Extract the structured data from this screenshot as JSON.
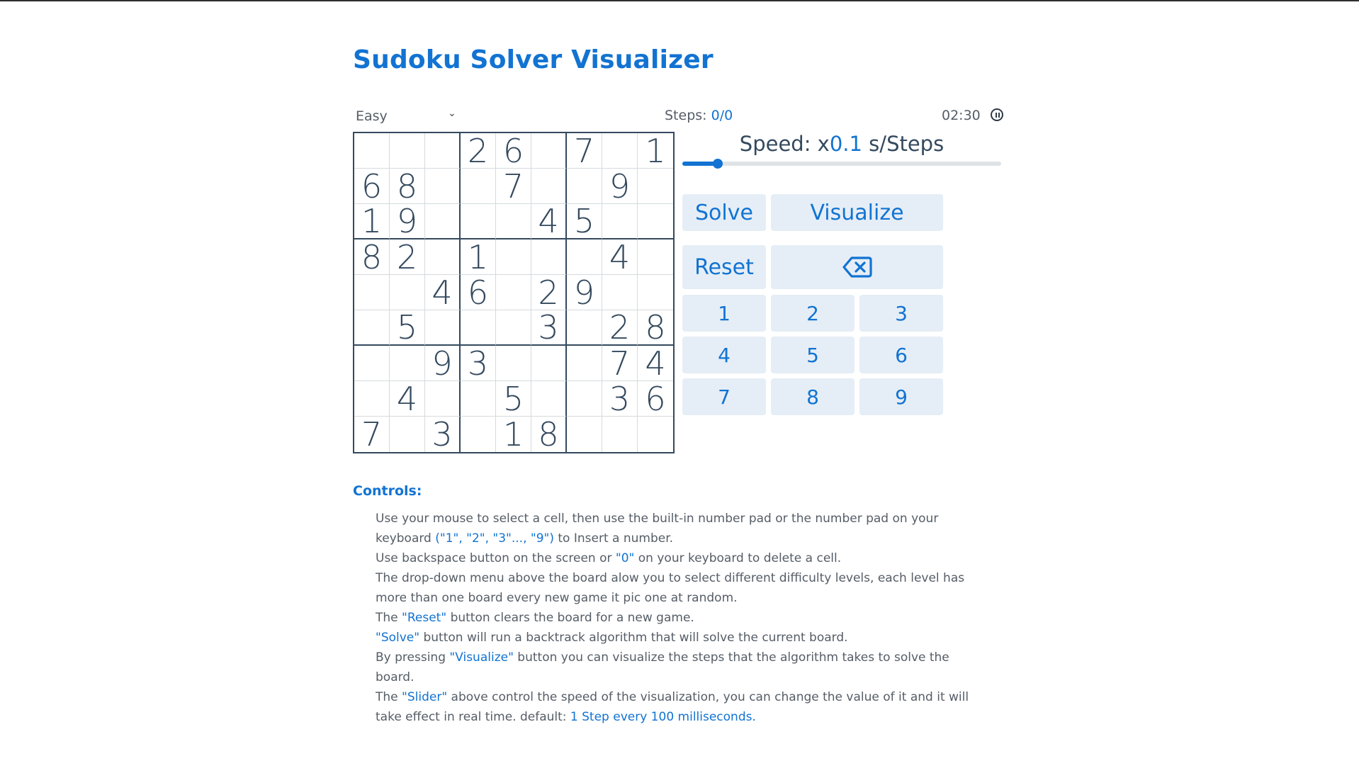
{
  "title": "Sudoku Solver Visualizer",
  "difficulty": {
    "selected": "Easy",
    "options": [
      "Easy"
    ]
  },
  "steps": {
    "label": "Steps:",
    "value": "0/0"
  },
  "timer": "02:30",
  "speed": {
    "label_prefix": "Speed: x",
    "value": "0.1",
    "label_suffix": " s/Steps",
    "slider_level": 0.11
  },
  "buttons": {
    "solve": "Solve",
    "visualize": "Visualize",
    "reset": "Reset",
    "backspace_icon": "backspace-icon"
  },
  "numpad": [
    "1",
    "2",
    "3",
    "4",
    "5",
    "6",
    "7",
    "8",
    "9"
  ],
  "board": [
    [
      "",
      "",
      "",
      "2",
      "6",
      "",
      "7",
      "",
      "1"
    ],
    [
      "6",
      "8",
      "",
      "",
      "7",
      "",
      "",
      "9",
      ""
    ],
    [
      "1",
      "9",
      "",
      "",
      "",
      "4",
      "5",
      "",
      ""
    ],
    [
      "8",
      "2",
      "",
      "1",
      "",
      "",
      "",
      "4",
      ""
    ],
    [
      "",
      "",
      "4",
      "6",
      "",
      "2",
      "9",
      "",
      ""
    ],
    [
      "",
      "5",
      "",
      "",
      "",
      "3",
      "",
      "2",
      "8"
    ],
    [
      "",
      "",
      "9",
      "3",
      "",
      "",
      "",
      "7",
      "4"
    ],
    [
      "",
      "4",
      "",
      "",
      "5",
      "",
      "",
      "3",
      "6"
    ],
    [
      "7",
      "",
      "3",
      "",
      "1",
      "8",
      "",
      "",
      ""
    ]
  ],
  "controls": {
    "heading": "Controls:",
    "items": [
      {
        "t1": "Use your mouse to select a cell, then use the built-in number pad or the number pad on your keyboard ",
        "h1": "(\"1\", \"2\", \"3\"..., \"9\")",
        "t2": " to Insert a number."
      },
      {
        "t1": "Use backspace button on the screen or ",
        "h1": "\"0\"",
        "t2": " on your keyboard to delete a cell."
      },
      {
        "t1": "The drop-down menu above the board alow you to select different difficulty levels, each level has more than one board every new game it pic one at random."
      },
      {
        "t1": "The ",
        "h1": "\"Reset\"",
        "t2": " button clears the board for a new game."
      },
      {
        "h1": "\"Solve\"",
        "t2": " button will run a backtrack algorithm that will solve the current board."
      },
      {
        "t1": "By pressing ",
        "h1": "\"Visualize\"",
        "t2": " button you can visualize the steps that the algorithm takes to solve the board."
      },
      {
        "t1": "The ",
        "h1": "\"Slider\"",
        "t2": " above control the speed of the visualization, you can change the value of it and it will take effect in real time. default: ",
        "h2": "1 Step every 100 milliseconds."
      }
    ]
  },
  "colors": {
    "accent": "#1273d2",
    "button_bg": "#e5eef6",
    "board_text": "#34495e"
  }
}
